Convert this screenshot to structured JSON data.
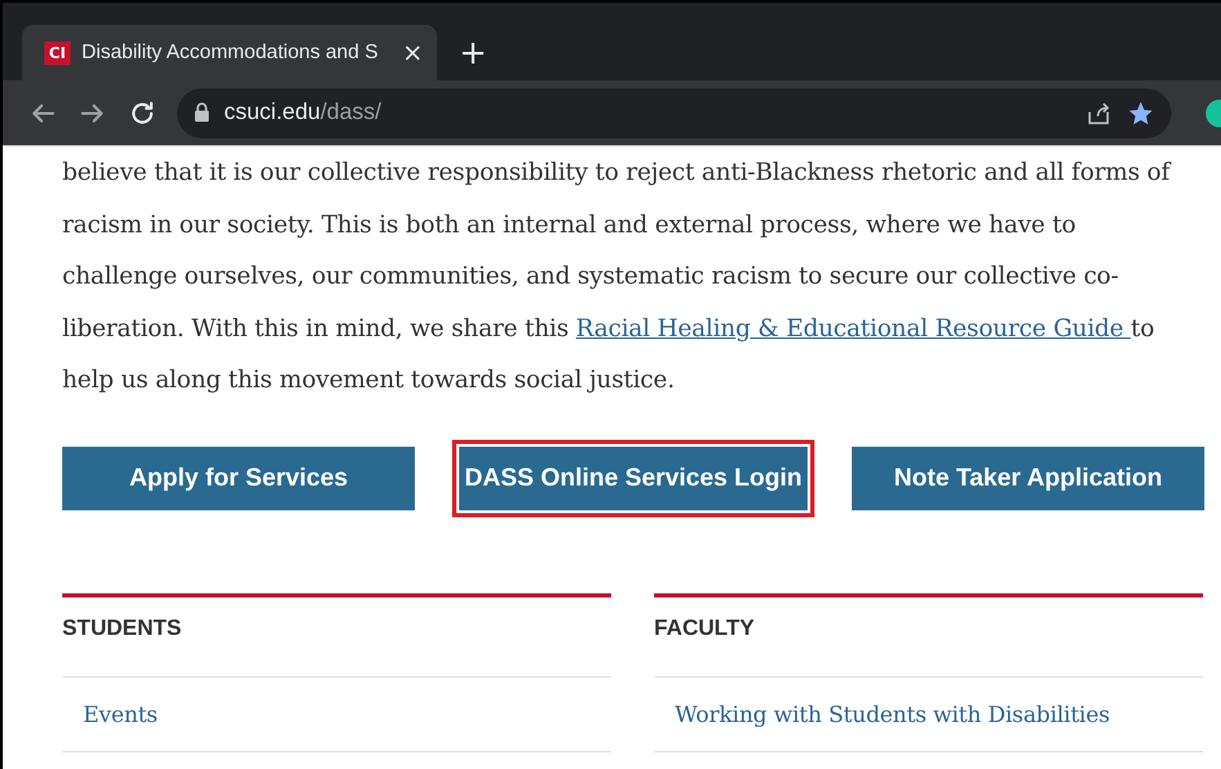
{
  "browser": {
    "tab": {
      "favicon": "CI",
      "title": "Disability Accommodations and S",
      "close": "×"
    },
    "new_tab": "+",
    "address": {
      "host": "csuci.edu",
      "path": "/dass/"
    }
  },
  "intro": {
    "text": "believe that it is our collective responsibility to reject anti-Blackness rhetoric and all forms of racism in our society. This is both an internal and external process, where we have to challenge ourselves, our communities, and systematic racism to secure our collective co-liberation. With this in mind, we share this ",
    "link": "Racial Healing & Educational Resource Guide ",
    "after": "to help us along this movement towards social justice."
  },
  "buttons": [
    {
      "label": "Apply for Services",
      "highlighted": false
    },
    {
      "label": "DASS Online Services Login",
      "highlighted": true
    },
    {
      "label": "Note Taker Application",
      "highlighted": false
    }
  ],
  "sections": [
    {
      "heading": "STUDENTS",
      "links": [
        "Events"
      ]
    },
    {
      "heading": "FACULTY",
      "links": [
        "Working with Students with Disabilities"
      ]
    }
  ]
}
